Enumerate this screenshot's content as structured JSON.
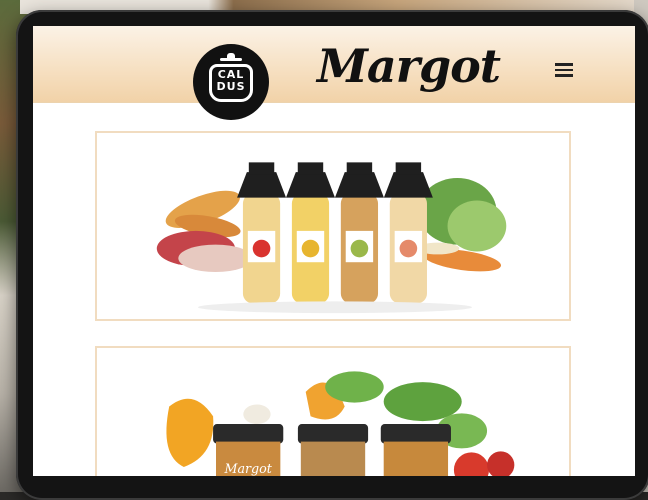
{
  "site": {
    "logo_text_line1": "CAL",
    "logo_text_line2": "DUS",
    "brand_name": "Margot",
    "menu_icon": "hamburger-menu-icon"
  },
  "products": [
    {
      "image": "soup-bottles-with-vegetables"
    },
    {
      "image": "cream-jars-with-squash-and-herbs",
      "jar_label": "Margot"
    }
  ],
  "colors": {
    "header_gradient_top": "#fbf2e6",
    "header_gradient_bottom": "#f1d2a8",
    "card_border": "#f1dcc0",
    "tablet_bezel": "#141414"
  }
}
